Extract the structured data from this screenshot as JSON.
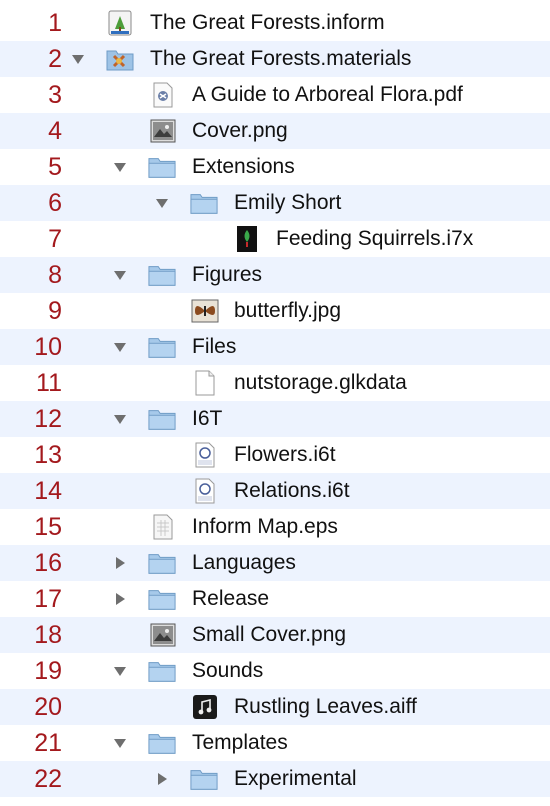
{
  "items": [
    {
      "n": "1",
      "label": "The Great Forests.inform",
      "icon": "inform-project-icon",
      "disclosure": "none"
    },
    {
      "n": "2",
      "label": "The Great Forests.materials",
      "icon": "materials-folder-icon",
      "disclosure": "expanded"
    },
    {
      "n": "3",
      "label": "A Guide to Arboreal Flora.pdf",
      "icon": "pdf-document-icon",
      "disclosure": "none"
    },
    {
      "n": "4",
      "label": "Cover.png",
      "icon": "image-file-icon",
      "disclosure": "none"
    },
    {
      "n": "5",
      "label": "Extensions",
      "icon": "folder-icon",
      "disclosure": "expanded"
    },
    {
      "n": "6",
      "label": "Emily Short",
      "icon": "folder-icon",
      "disclosure": "expanded"
    },
    {
      "n": "7",
      "label": "Feeding Squirrels.i7x",
      "icon": "i7x-extension-icon",
      "disclosure": "none"
    },
    {
      "n": "8",
      "label": "Figures",
      "icon": "folder-icon",
      "disclosure": "expanded"
    },
    {
      "n": "9",
      "label": "butterfly.jpg",
      "icon": "butterfly-image-icon",
      "disclosure": "none"
    },
    {
      "n": "10",
      "label": "Files",
      "icon": "folder-icon",
      "disclosure": "expanded"
    },
    {
      "n": "11",
      "label": "nutstorage.glkdata",
      "icon": "blank-document-icon",
      "disclosure": "none"
    },
    {
      "n": "12",
      "label": "I6T",
      "icon": "folder-icon",
      "disclosure": "expanded"
    },
    {
      "n": "13",
      "label": "Flowers.i6t",
      "icon": "text-file-icon",
      "disclosure": "none"
    },
    {
      "n": "14",
      "label": "Relations.i6t",
      "icon": "text-file-icon",
      "disclosure": "none"
    },
    {
      "n": "15",
      "label": "Inform Map.eps",
      "icon": "eps-document-icon",
      "disclosure": "none"
    },
    {
      "n": "16",
      "label": "Languages",
      "icon": "folder-icon",
      "disclosure": "collapsed"
    },
    {
      "n": "17",
      "label": "Release",
      "icon": "folder-icon",
      "disclosure": "collapsed"
    },
    {
      "n": "18",
      "label": "Small Cover.png",
      "icon": "image-file-icon",
      "disclosure": "none"
    },
    {
      "n": "19",
      "label": "Sounds",
      "icon": "folder-icon",
      "disclosure": "expanded"
    },
    {
      "n": "20",
      "label": "Rustling Leaves.aiff",
      "icon": "audio-file-icon",
      "disclosure": "none"
    },
    {
      "n": "21",
      "label": "Templates",
      "icon": "folder-icon",
      "disclosure": "expanded"
    },
    {
      "n": "22",
      "label": "Experimental",
      "icon": "folder-icon",
      "disclosure": "collapsed"
    }
  ],
  "colors": {
    "line_number": "#a3191d",
    "stripe": "#edf3fe",
    "folder": "#9ec3e6"
  }
}
